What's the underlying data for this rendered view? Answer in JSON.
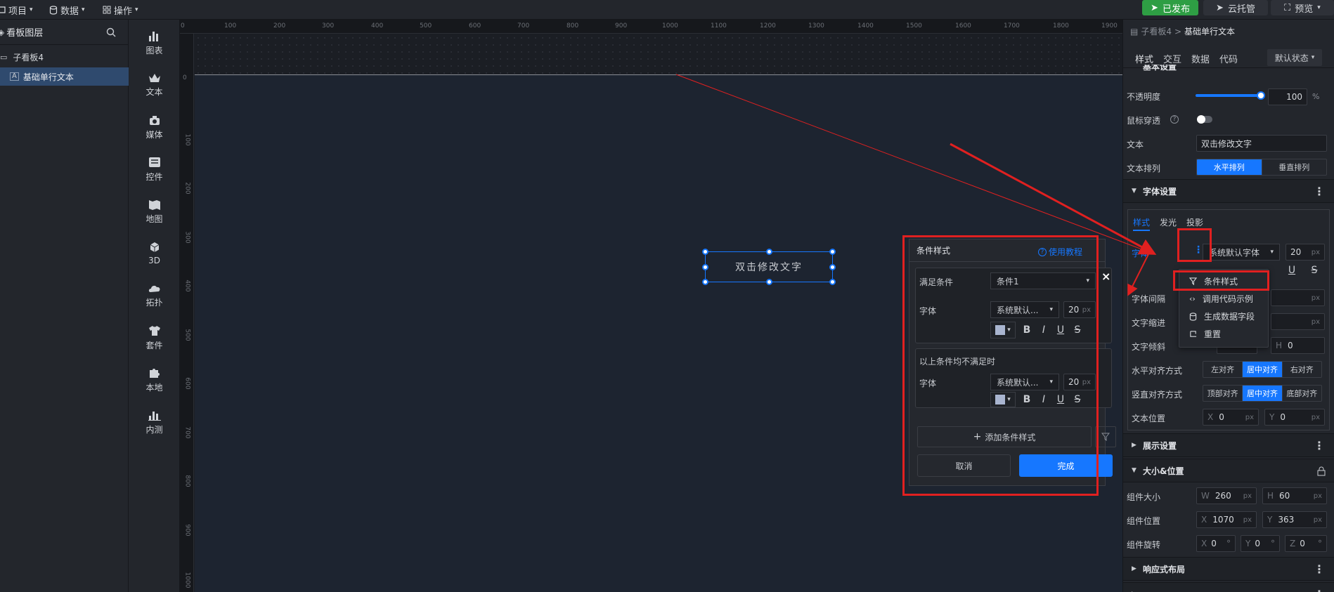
{
  "topbar": {
    "menus": [
      {
        "label": "项目",
        "icon": "project-icon"
      },
      {
        "label": "数据",
        "icon": "database-icon"
      },
      {
        "label": "操作",
        "icon": "grid-icon"
      }
    ],
    "publish": "已发布",
    "cloud": "云托管",
    "preview": "预览"
  },
  "layers": {
    "title": "看板图层",
    "items": [
      {
        "label": "子看板4"
      },
      {
        "label": "基础单行文本"
      }
    ]
  },
  "tools": [
    {
      "label": "图表",
      "icon": "chart-icon"
    },
    {
      "label": "文本",
      "icon": "crown-icon"
    },
    {
      "label": "媒体",
      "icon": "media-icon"
    },
    {
      "label": "控件",
      "icon": "control-icon"
    },
    {
      "label": "地图",
      "icon": "map-icon"
    },
    {
      "label": "3D",
      "icon": "cube-icon"
    },
    {
      "label": "拓扑",
      "icon": "topology-icon"
    },
    {
      "label": "套件",
      "icon": "shirt-icon"
    },
    {
      "label": "本地",
      "icon": "puzzle-icon"
    },
    {
      "label": "内测",
      "icon": "beta-chart-icon"
    }
  ],
  "ruler": {
    "h": [
      "0",
      "100",
      "200",
      "300",
      "400",
      "500",
      "600",
      "700",
      "800",
      "900",
      "1000",
      "1100",
      "1200",
      "1300",
      "1400",
      "1500",
      "1600",
      "1700",
      "1800",
      "1900"
    ],
    "v": [
      "0",
      "100",
      "200",
      "300",
      "400",
      "500",
      "600",
      "700",
      "800",
      "900",
      "1000"
    ]
  },
  "canvas": {
    "widget_text": "双击修改文字"
  },
  "modal": {
    "title": "条件样式",
    "tutorial": "使用教程",
    "cond_label": "满足条件",
    "cond_value": "条件1",
    "font_label": "字体",
    "font_value": "系统默认...",
    "size": "20",
    "unit": "px",
    "else_label": "以上条件均不满足时",
    "font_label2": "字体",
    "font_value2": "系统默认...",
    "size2": "20",
    "add": "添加条件样式",
    "cancel": "取消",
    "done": "完成",
    "bold": "B",
    "italic": "I",
    "underline": "U",
    "strike": "S",
    "close": "×"
  },
  "right": {
    "breadcrumb_parent": "子看板4",
    "breadcrumb_sep": ">",
    "breadcrumb_current": "基础单行文本",
    "tabs": [
      "样式",
      "交互",
      "数据",
      "代码"
    ],
    "state": "默认状态",
    "basic_title": "基本设置",
    "opacity_label": "不透明度",
    "opacity_value": "100",
    "opacity_level": 1.0,
    "pct": "%",
    "mouse_label": "鼠标穿透",
    "text_label": "文本",
    "text_value": "双击修改文字",
    "arrange_label": "文本排列",
    "arrange_options": [
      "水平排列",
      "垂直排列"
    ],
    "font_section": "字体设置",
    "font_tabs": [
      "样式",
      "发光",
      "投影"
    ],
    "font_label": "字体",
    "font_value": "系统默认字体",
    "font_size": "20",
    "unit": "px",
    "spacing_label": "字体间隔",
    "indent_label": "文字缩进",
    "skew_label": "文字倾斜",
    "skew_h": "H",
    "skew_h_value": "0",
    "halign_label": "水平对齐方式",
    "halign_options": [
      "左对齐",
      "居中对齐",
      "右对齐"
    ],
    "valign_label": "竖直对齐方式",
    "valign_options": [
      "顶部对齐",
      "居中对齐",
      "底部对齐"
    ],
    "pos_label": "文本位置",
    "pos_x": "X",
    "pos_x_value": "0",
    "pos_y": "Y",
    "pos_y_value": "0",
    "display_section": "展示设置",
    "size_section": "大小&位置",
    "comp_size_label": "组件大小",
    "w": "W",
    "w_value": "260",
    "h": "H",
    "h_value": "60",
    "comp_pos_label": "组件位置",
    "x": "X",
    "x_value": "1070",
    "y": "Y",
    "y_value": "363",
    "rot_label": "组件旋转",
    "rx": "X",
    "rx_value": "0",
    "ry": "Y",
    "ry_value": "0",
    "rz": "Z",
    "rz_value": "0",
    "deg": "°",
    "responsive_section": "响应式布局"
  },
  "dropdown": {
    "items": [
      {
        "label": "条件样式",
        "icon": "filter-icon"
      },
      {
        "label": "调用代码示例",
        "icon": "code-icon"
      },
      {
        "label": "生成数据字段",
        "icon": "database-icon"
      },
      {
        "label": "重置",
        "icon": "reset-icon"
      }
    ]
  },
  "colors": {
    "accent": "#1677ff",
    "publish": "#2e9e44",
    "annotation": "#e02020"
  }
}
